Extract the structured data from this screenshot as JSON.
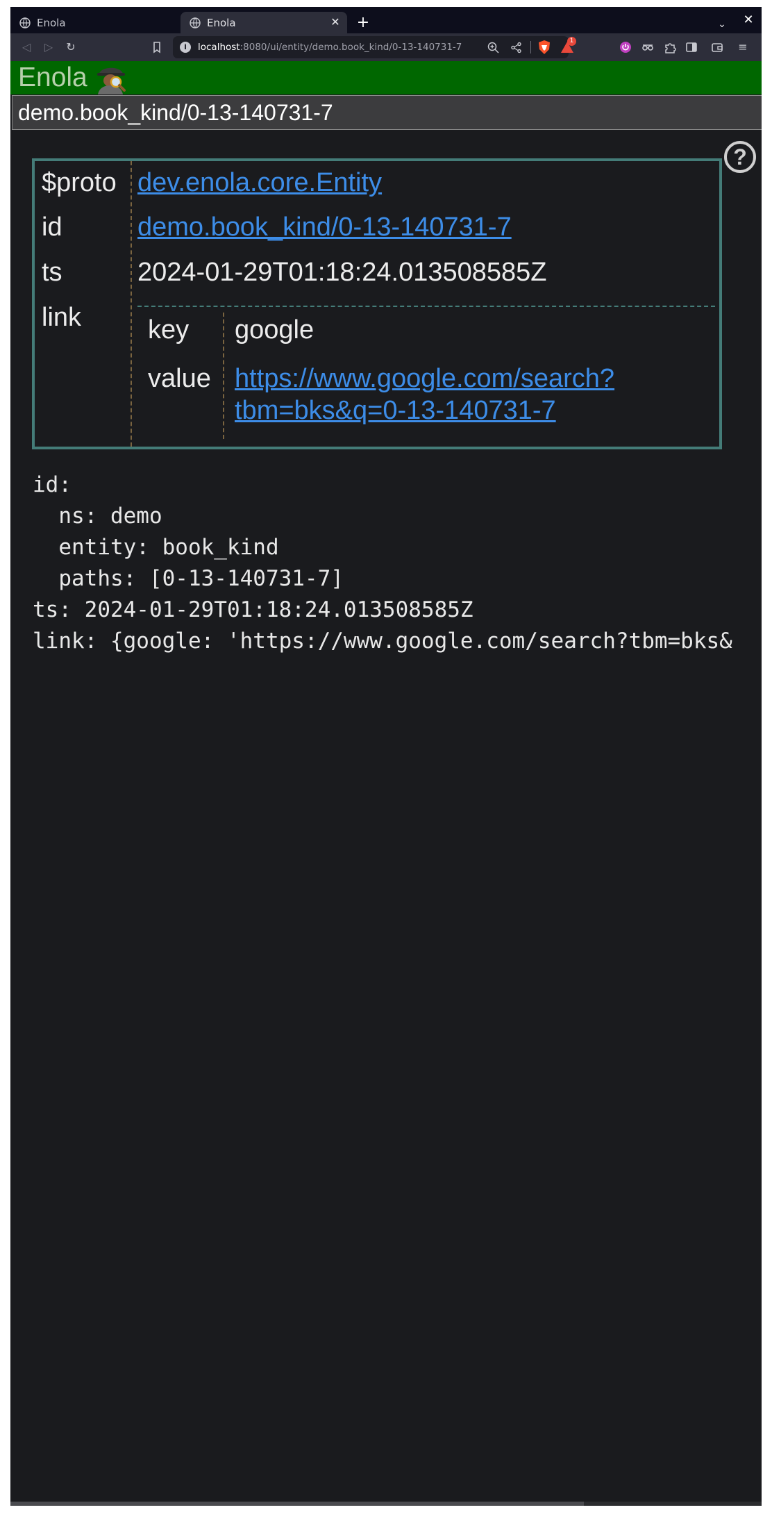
{
  "tabs": [
    {
      "label": "Enola"
    },
    {
      "label": "Enola"
    }
  ],
  "toolbar": {
    "url_host": "localhost",
    "url_rest": ":8080/ui/entity/demo.book_kind/0-13-140731-7",
    "rewards_badge": "1"
  },
  "page": {
    "app_title": "Enola",
    "search_value": "demo.book_kind/0-13-140731-7"
  },
  "entity": {
    "proto_label": "$proto",
    "proto_value": "dev.enola.core.Entity",
    "id_label": "id",
    "id_value": "demo.book_kind/0-13-140731-7",
    "ts_label": "ts",
    "ts_value": "2024-01-29T01:18:24.013508585Z",
    "link_label": "link",
    "link_key_label": "key",
    "link_key_value": "google",
    "link_value_label": "value",
    "link_value_line1": "https://www.google.com/search?",
    "link_value_line2": "tbm=bks&q=0-13-140731-7"
  },
  "yaml": [
    "id:",
    "  ns: demo",
    "  entity: book_kind",
    "  paths: [0-13-140731-7]",
    "ts: 2024-01-29T01:18:24.013508585Z",
    "link: {google: 'https://www.google.com/search?tbm=bks&"
  ],
  "colors": {
    "header_green": "#006700",
    "link_blue": "#3d8de8",
    "box_border": "#447c78",
    "page_bg": "#1a1b1e"
  }
}
